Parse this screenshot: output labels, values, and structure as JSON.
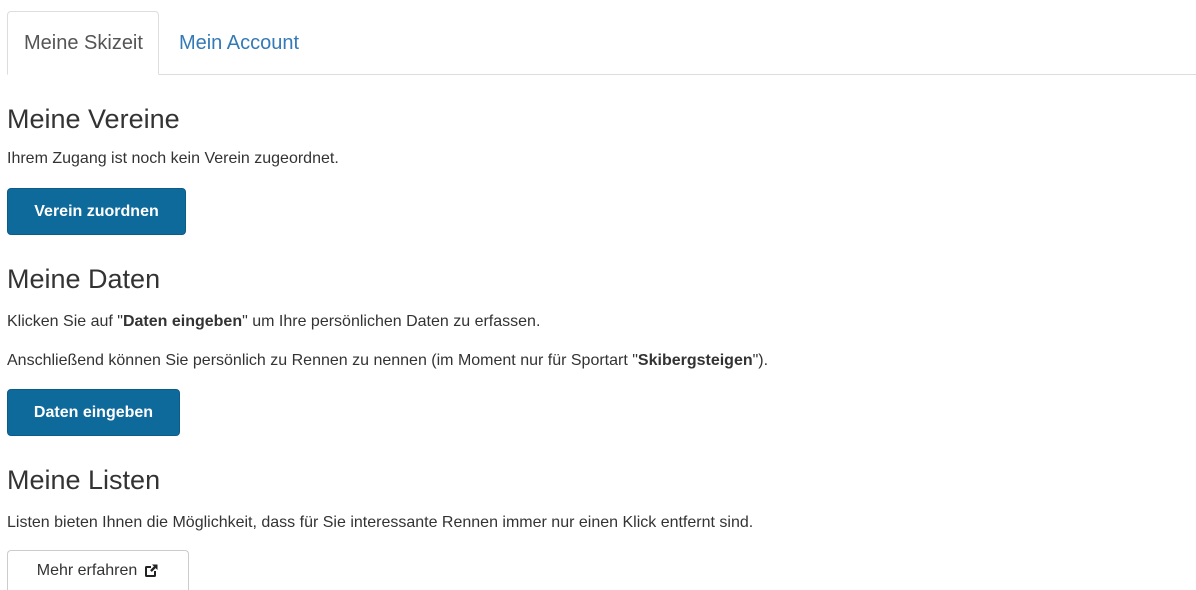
{
  "tabs": [
    {
      "label": "Meine Skizeit",
      "active": true
    },
    {
      "label": "Mein Account",
      "active": false
    }
  ],
  "vereine": {
    "title": "Meine Vereine",
    "text": "Ihrem Zugang ist noch kein Verein zugeordnet.",
    "button": "Verein zuordnen"
  },
  "daten": {
    "title": "Meine Daten",
    "line1_prefix": "Klicken Sie auf \"",
    "line1_bold": "Daten eingeben",
    "line1_suffix": "\" um Ihre persönlichen Daten zu erfassen.",
    "line2_prefix": "Anschließend können Sie persönlich zu Rennen zu nennen (im Moment nur für Sportart \"",
    "line2_bold": "Skibergsteigen",
    "line2_suffix": "\").",
    "button": "Daten eingeben"
  },
  "listen": {
    "title": "Meine Listen",
    "text": "Listen bieten Ihnen die Möglichkeit, dass für Sie interessante Rennen immer nur einen Klick entfernt sind.",
    "button": "Mehr erfahren",
    "button_icon": "external-link-icon"
  },
  "colors": {
    "primary_button": "#0f6a9c",
    "link": "#337ab7",
    "text": "#333333"
  }
}
